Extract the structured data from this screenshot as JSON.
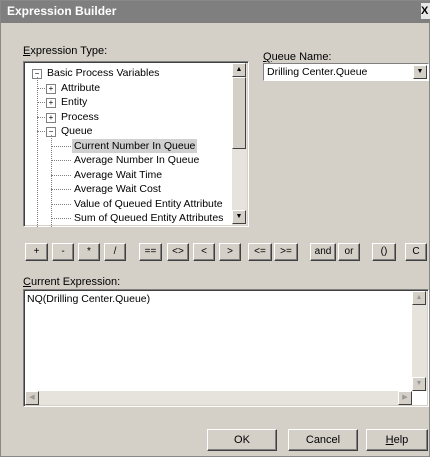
{
  "window": {
    "title": "Expression Builder",
    "close_label": "X"
  },
  "expression_type": {
    "label_prefix": "E",
    "label_rest": "xpression Type:",
    "tree": [
      {
        "label": "Basic Process Variables",
        "level": 0,
        "expander": "−"
      },
      {
        "label": "Attribute",
        "level": 1,
        "expander": "+"
      },
      {
        "label": "Entity",
        "level": 1,
        "expander": "+"
      },
      {
        "label": "Process",
        "level": 1,
        "expander": "+"
      },
      {
        "label": "Queue",
        "level": 1,
        "expander": "−"
      },
      {
        "label": "Current Number In Queue",
        "level": 2,
        "expander": ""
      },
      {
        "label": "Average Number In Queue",
        "level": 2,
        "expander": ""
      },
      {
        "label": "Average Wait Time",
        "level": 2,
        "expander": ""
      },
      {
        "label": "Average Wait Cost",
        "level": 2,
        "expander": ""
      },
      {
        "label": "Value of Queued Entity Attribute",
        "level": 2,
        "expander": ""
      },
      {
        "label": "Sum of Queued Entity Attributes",
        "level": 2,
        "expander": ""
      }
    ],
    "selected_index": 5
  },
  "queue_name": {
    "label_prefix": "Q",
    "label_rest": "ueue Name:",
    "value": "Drilling Center.Queue"
  },
  "operators": [
    "+",
    "-",
    "*",
    "/",
    "==",
    "<>",
    "<",
    ">",
    "<=",
    ">=",
    "and",
    "or",
    "()",
    "C"
  ],
  "current_expression": {
    "label_prefix": "C",
    "label_rest": "urrent Expression:",
    "value": "NQ(Drilling Center.Queue)"
  },
  "buttons": {
    "ok": "OK",
    "cancel": "Cancel",
    "help_prefix": "H",
    "help_rest": "elp"
  },
  "colors": {
    "titlebar": "#7f7f7f",
    "face": "#d4d0c8",
    "selection": "#d0d0d0"
  }
}
